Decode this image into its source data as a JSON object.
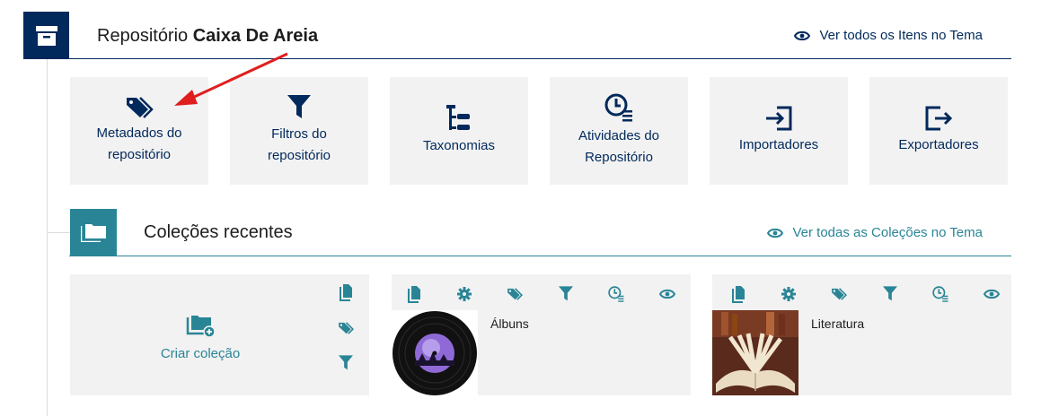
{
  "repository": {
    "title_prefix": "Repositório",
    "title_name": "Caixa De Areia",
    "view_all_link": "Ver todos os Itens no Tema"
  },
  "tiles": [
    {
      "label": "Metadados do\nrepositório",
      "icon": "tags-icon"
    },
    {
      "label": "Filtros do\nrepositório",
      "icon": "filter-icon"
    },
    {
      "label": "Taxonomias",
      "icon": "taxonomy-icon"
    },
    {
      "label": "Atividades do\nRepositório",
      "icon": "activity-clock-icon"
    },
    {
      "label": "Importadores",
      "icon": "import-icon"
    },
    {
      "label": "Exportadores",
      "icon": "export-icon"
    }
  ],
  "collections": {
    "title": "Coleções recentes",
    "view_all_link": "Ver todas as Coleções no Tema",
    "create_label": "Criar coleção",
    "items": [
      {
        "name": "Álbuns",
        "thumbnail": "vinyl-record"
      },
      {
        "name": "Literatura",
        "thumbnail": "open-book"
      }
    ]
  },
  "colors": {
    "navy": "#01295c",
    "teal": "#298596",
    "tile_bg": "#f2f2f2",
    "arrow": "#e01e1e"
  }
}
